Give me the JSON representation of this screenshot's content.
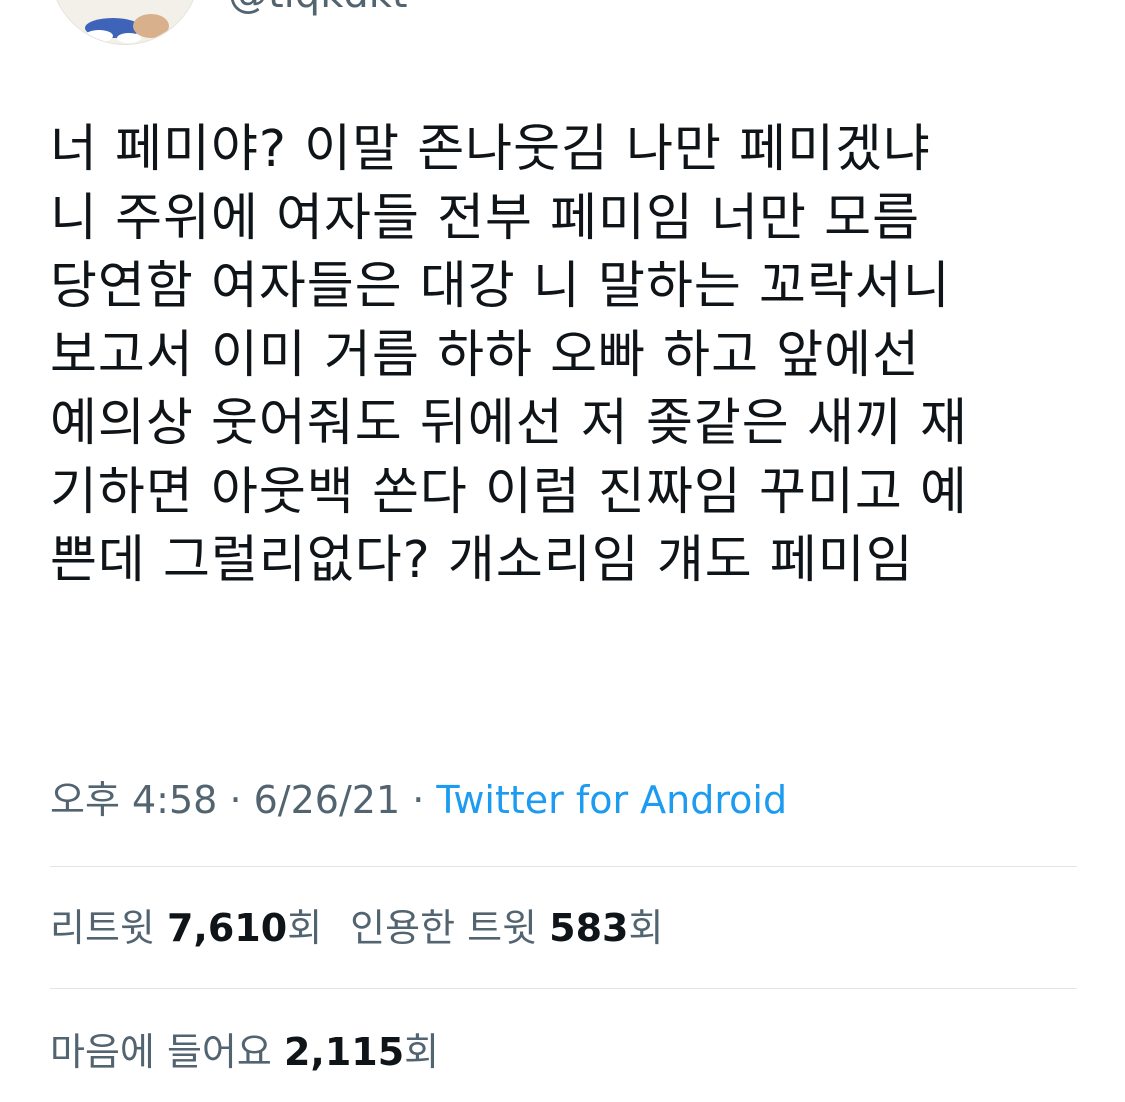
{
  "user": {
    "handle": "@tiqkdkt"
  },
  "tweet": {
    "lines": [
      "너 페미야? 이말 존나웃김 나만 페미겠냐",
      "니 주위에 여자들 전부 페미임 너만 모름",
      "당연함 여자들은 대강 니 말하는 꼬락서니",
      "보고서 이미 거름 하하 오빠 하고 앞에선",
      "예의상 웃어줘도 뒤에선 저 좆같은 새끼 재",
      "기하면 아웃백 쏜다 이럼 진짜임 꾸미고 예",
      "쁜데 그럴리없다? 개소리임 걔도 페미임"
    ],
    "time": "오후 4:58",
    "separator": "·",
    "date": "6/26/21",
    "source": "Twitter for Android"
  },
  "stats": {
    "retweets_label": "리트윗",
    "retweets_count": "7,610",
    "retweets_unit": "회",
    "quotes_label": "인용한 트윗",
    "quotes_count": "583",
    "quotes_unit": "회",
    "likes_label": "마음에 들어요",
    "likes_count": "2,115",
    "likes_unit": "회"
  },
  "colors": {
    "text": "#0f1419",
    "secondary": "#536471",
    "link": "#1d9bf0",
    "divider": "#e1e5e8"
  }
}
